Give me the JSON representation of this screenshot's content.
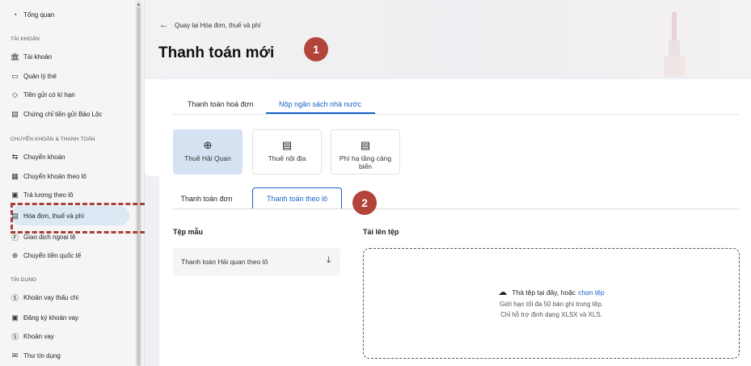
{
  "sidebar": {
    "overview": "Tổng quan",
    "section_account": "TÀI KHOẢN",
    "account": "Tài khoản",
    "card_mgmt": "Quản lý thẻ",
    "term_deposit": "Tiền gửi có kì hạn",
    "certificate": "Chứng chỉ tiền gửi Bảo Lộc",
    "section_transfer": "CHUYỂN KHOẢN & THANH TOÁN",
    "transfer": "Chuyển khoản",
    "batch_transfer": "Chuyển khoản theo lô",
    "batch_salary": "Trả lương theo lô",
    "invoice_tax": "Hóa đơn, thuế và phí",
    "fx": "Giao dịch ngoại tệ",
    "intl_transfer": "Chuyển tiền quốc tế",
    "section_credit": "TÍN DỤNG",
    "overdraft": "Khoản vay thấu chi",
    "loan_register": "Đăng ký khoản vay",
    "loan": "Khoản vay",
    "credit_letter": "Thư tín dụng"
  },
  "header": {
    "back_label": "Quay lại Hóa đơn, thuế và phí",
    "title": "Thanh toán mới"
  },
  "badges": {
    "b1": "1",
    "b2": "2"
  },
  "tabs": {
    "invoice_payment": "Thanh toán hoá đơn",
    "state_budget": "Nộp ngân sách nhà nước"
  },
  "tiles": {
    "customs": "Thuế Hải Quan",
    "domestic": "Thuế nội địa",
    "port_fee": "Phí hạ tầng cảng biển"
  },
  "subtabs": {
    "single": "Thanh toán đơn",
    "batch": "Thanh toán theo lô"
  },
  "template": {
    "label": "Tệp mẫu",
    "file": "Thanh toán Hải quan theo lô"
  },
  "upload": {
    "label": "Tải lên tệp",
    "drop_text": "Thả tệp tại đây, hoặc",
    "choose": "chọn tệp",
    "limit": "Giới hạn tối đa 50 bản ghi trong tệp.",
    "formats": "Chỉ hỗ trợ định dạng XLSX và XLS."
  },
  "colors": {
    "accent": "#1762c9",
    "badge": "#b2443a",
    "dashed": "#a8403a"
  }
}
